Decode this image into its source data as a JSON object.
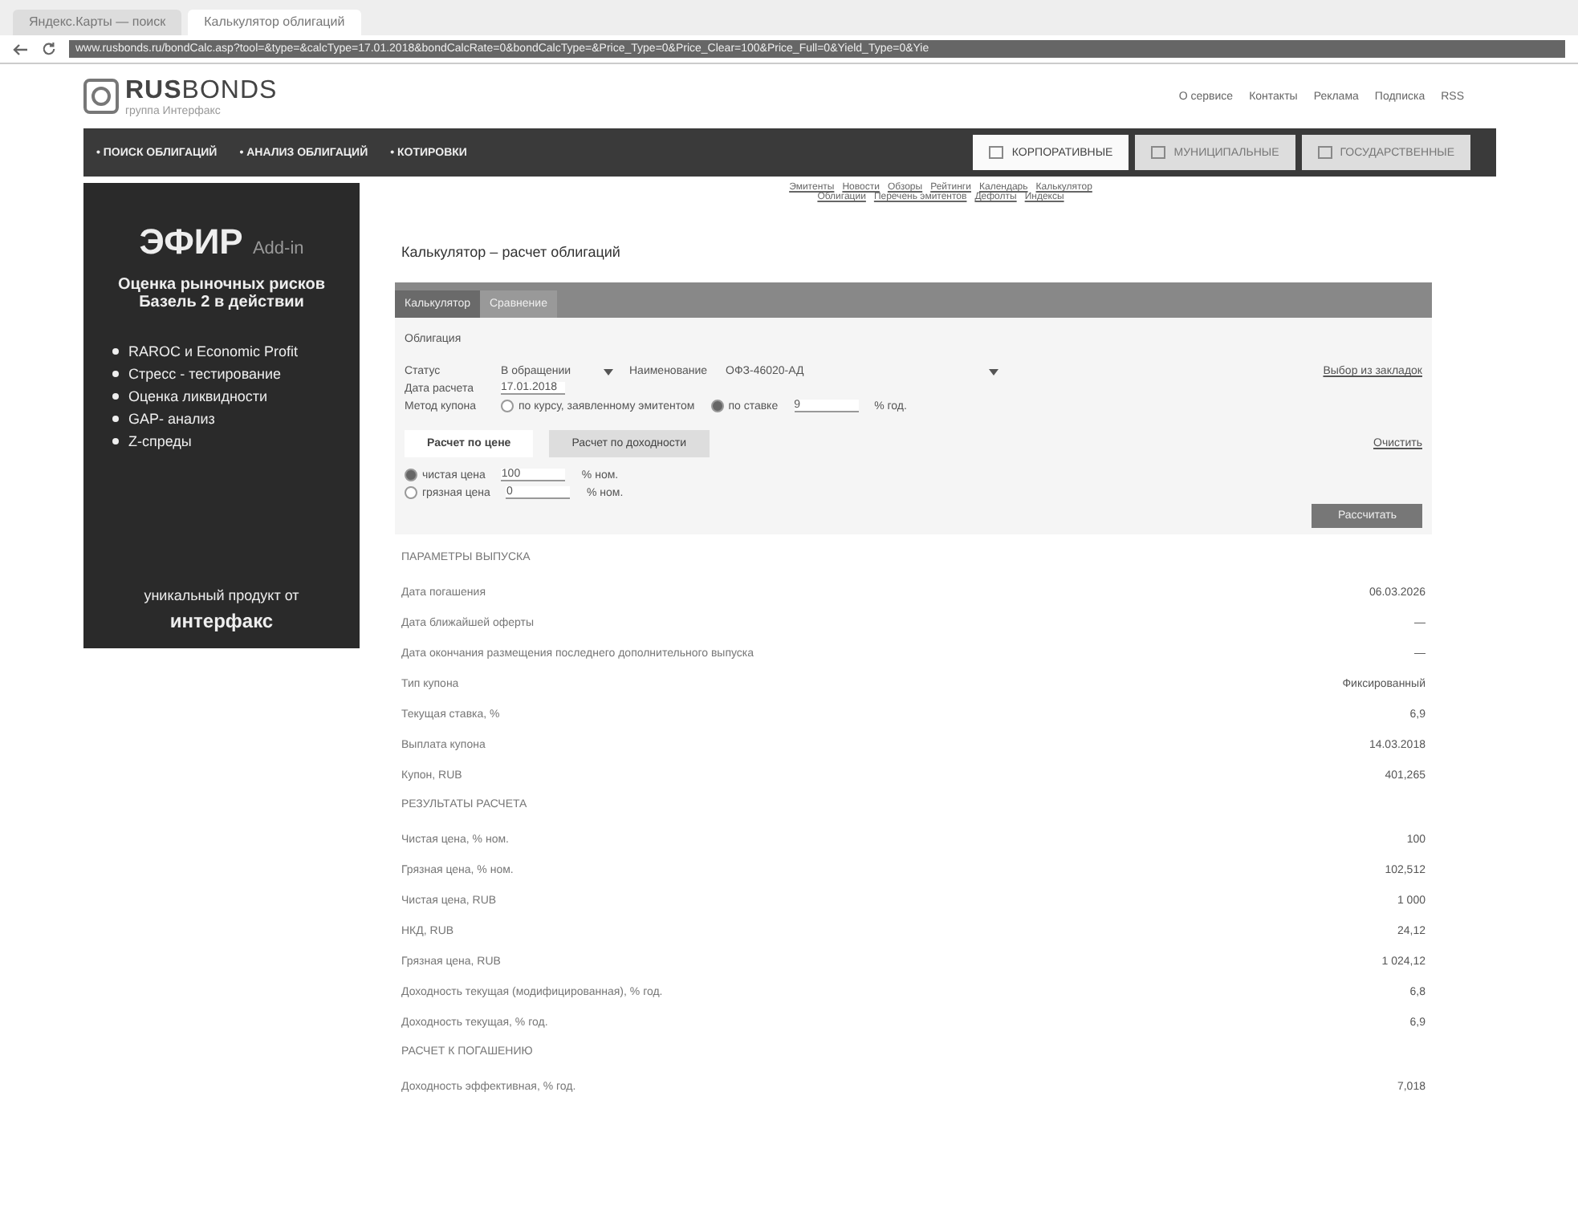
{
  "browser": {
    "tabs": [
      {
        "label": "Яндекс.Карты — поиск",
        "selected": false
      },
      {
        "label": "Калькулятор облигаций",
        "selected": true
      }
    ],
    "url": "www.rusbonds.ru/bondCalc.asp?tool=&type=&calcType=17.01.2018&bondCalcRate=0&bondCalcType=&Price_Type=0&Price_Clear=100&Price_Full=0&Yield_Type=0&Yie"
  },
  "header": {
    "logo_bold": "RUS",
    "logo_light": "BONDS",
    "logo_sub": "группа Интерфакс",
    "links": [
      "О сервисе",
      "Контакты",
      "Реклама",
      "Подписка",
      "RSS"
    ]
  },
  "nav": {
    "items": [
      "• ПОИСК ОБЛИГАЦИЙ",
      "• АНАЛИЗ ОБЛИГАЦИЙ",
      "• КОТИРОВКИ"
    ],
    "tabs": [
      {
        "label": "КОРПОРАТИВНЫЕ",
        "selected": true
      },
      {
        "label": "МУНИЦИПАЛЬНЫЕ",
        "selected": false
      },
      {
        "label": "ГОСУДАРСТВЕННЫЕ",
        "selected": false
      }
    ],
    "sublinks": [
      [
        "Эмитенты",
        "Новости",
        "Обзоры",
        "Рейтинги",
        "Календарь",
        "Калькулятор"
      ],
      [
        "Облигации",
        "Перечень эмитентов",
        "Дефолты",
        "Индексы"
      ]
    ]
  },
  "banner": {
    "title": "ЭФИР",
    "title_small": "Add-in",
    "subtitle": "Оценка рыночных рисков Базель 2 в действии",
    "bullets": [
      "RAROC и Economic Profit",
      "Стресс - тестирование",
      "Оценка ликвидности",
      "GAP- анализ",
      "Z-спреды"
    ],
    "footer": "уникальный продукт от",
    "brand": "интерфакс"
  },
  "calc": {
    "title": "Калькулятор – расчет облигаций",
    "tabs": [
      {
        "label": "Калькулятор",
        "selected": false
      },
      {
        "label": "Сравнение",
        "selected": true
      }
    ],
    "section": "Облигация",
    "status_label": "Статус",
    "status": "В обращении",
    "name_label": "Наименование",
    "name": "ОФЗ-46020-АД",
    "side_link": "Выбор из закладок",
    "date_label": "Дата расчета",
    "date": "17.01.2018",
    "coupon_label": "Метод купона",
    "coupon_opts": [
      {
        "label": "по курсу, заявленному эмитентом",
        "selected": false
      },
      {
        "label": "по ставке",
        "selected": true
      }
    ],
    "rate": "9",
    "rate_unit": "% год.",
    "modes": [
      {
        "label": "Расчет по цене",
        "selected": true
      },
      {
        "label": "Расчет по доходности",
        "selected": false
      }
    ],
    "clear": "Очистить",
    "prices": [
      {
        "label": "чистая цена",
        "value": "100",
        "unit": "% ном.",
        "selected": true
      },
      {
        "label": "грязная цена",
        "value": "0",
        "unit": "% ном.",
        "selected": false
      }
    ],
    "submit": "Рассчитать"
  },
  "results": [
    {
      "kind": "heading",
      "label": "ПАРАМЕТРЫ ВЫПУСКА"
    },
    {
      "kind": "row",
      "label": "Дата погашения",
      "value": "06.03.2026"
    },
    {
      "kind": "row",
      "label": "Дата ближайшей оферты",
      "value": "—"
    },
    {
      "kind": "row",
      "label": "Дата окончания размещения последнего дополнительного выпуска",
      "value": "—"
    },
    {
      "kind": "row",
      "label": "Тип купона",
      "value": "Фиксированный"
    },
    {
      "kind": "row",
      "label": "Текущая ставка, %",
      "value": "6,9"
    },
    {
      "kind": "row",
      "label": "Выплата купона",
      "value": "14.03.2018"
    },
    {
      "kind": "row",
      "label": "Купон, RUB",
      "value": "401,265"
    },
    {
      "kind": "heading",
      "label": "РЕЗУЛЬТАТЫ РАСЧЕТА"
    },
    {
      "kind": "row",
      "label": "Чистая цена, % ном.",
      "value": "100"
    },
    {
      "kind": "row",
      "label": "Грязная цена, % ном.",
      "value": "102,512"
    },
    {
      "kind": "row",
      "label": "Чистая цена, RUB",
      "value": "1 000"
    },
    {
      "kind": "row",
      "label": "НКД, RUB",
      "value": "24,12"
    },
    {
      "kind": "row",
      "label": "Грязная цена, RUB",
      "value": "1 024,12"
    },
    {
      "kind": "row",
      "label": "Доходность текущая (модифицированная), % год.",
      "value": "6,8"
    },
    {
      "kind": "row",
      "label": "Доходность текущая, % год.",
      "value": "6,9"
    },
    {
      "kind": "heading",
      "label": "РАСЧЕТ К ПОГАШЕНИЮ"
    },
    {
      "kind": "row",
      "label": "Доходность эффективная, % год.",
      "value": "7,018"
    }
  ]
}
